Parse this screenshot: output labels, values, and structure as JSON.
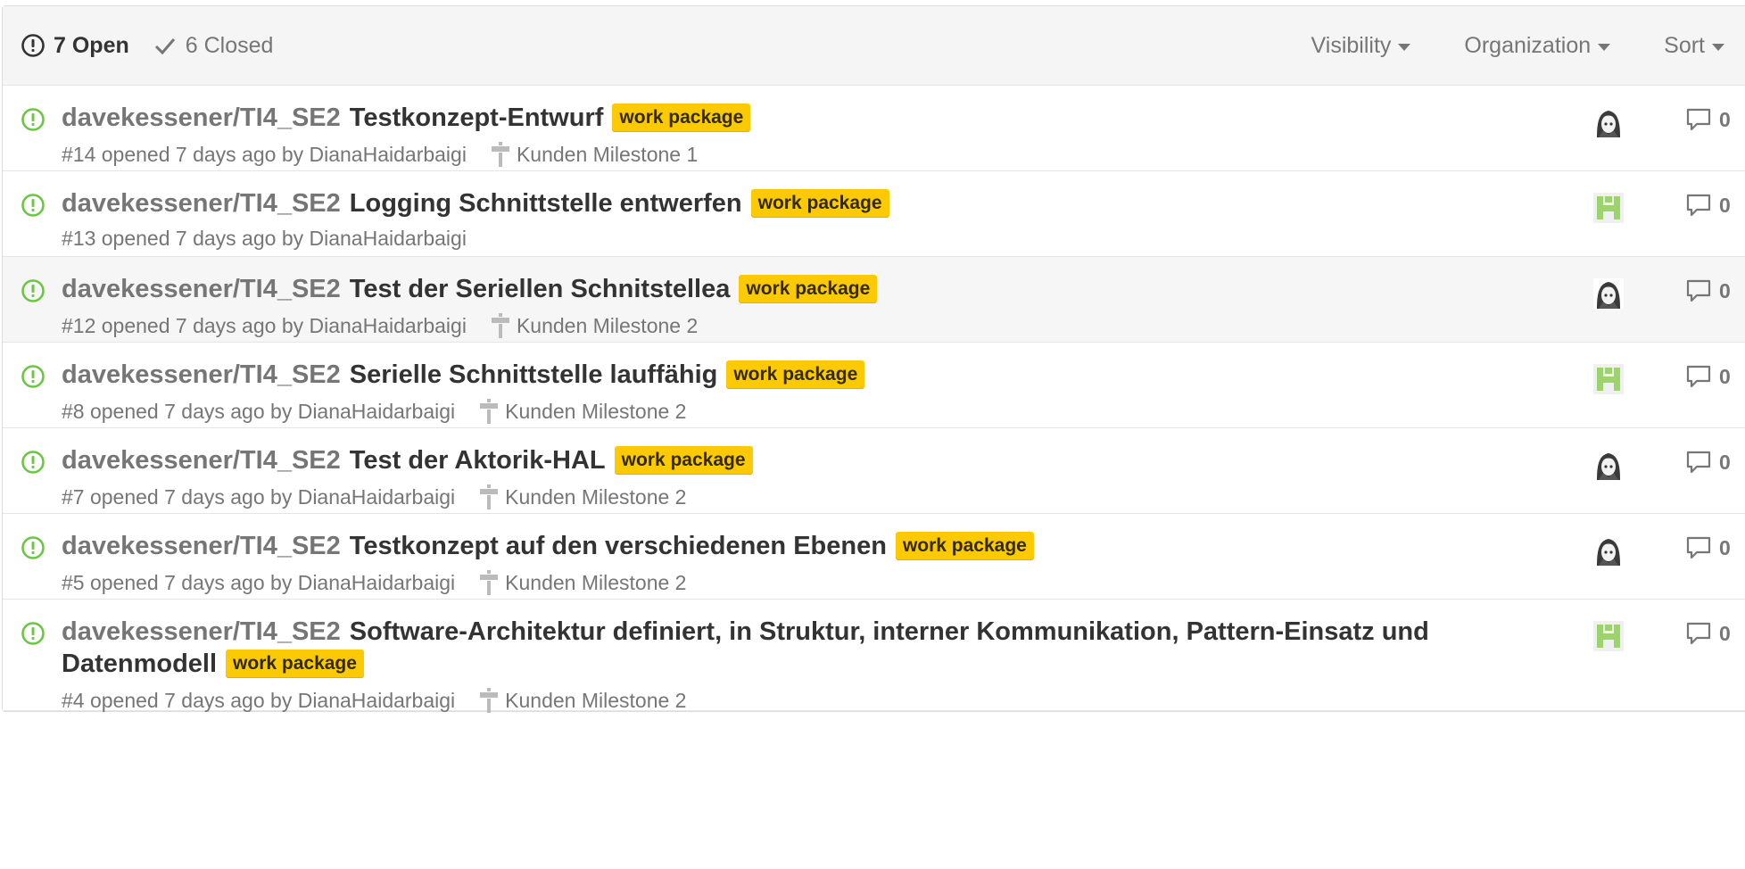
{
  "header": {
    "open_label": "7 Open",
    "closed_label": "6 Closed",
    "filters": [
      "Visibility",
      "Organization",
      "Sort"
    ]
  },
  "colors": {
    "open_icon": "#6cc644",
    "label_bg": "#fbca04",
    "muted": "#767676"
  },
  "issues": [
    {
      "repo": "davekessener/TI4_SE2",
      "title": "Testkonzept-Entwurf",
      "label": "work package",
      "meta": "#14 opened 7 days ago by DianaHaidarbaigi",
      "milestone": "Kunden Milestone 1",
      "avatar_icon": "anime-avatar",
      "comments": "0"
    },
    {
      "repo": "davekessener/TI4_SE2",
      "title": "Logging Schnittstelle entwerfen",
      "label": "work package",
      "meta": "#13 opened 7 days ago by DianaHaidarbaigi",
      "milestone": "",
      "avatar_icon": "identicon-avatar",
      "comments": "0"
    },
    {
      "repo": "davekessener/TI4_SE2",
      "title": "Test der Seriellen Schnitstellea",
      "label": "work package",
      "meta": "#12 opened 7 days ago by DianaHaidarbaigi",
      "milestone": "Kunden Milestone 2",
      "avatar_icon": "anime-avatar",
      "comments": "0"
    },
    {
      "repo": "davekessener/TI4_SE2",
      "title": "Serielle Schnittstelle lauffähig",
      "label": "work package",
      "meta": "#8 opened 7 days ago by DianaHaidarbaigi",
      "milestone": "Kunden Milestone 2",
      "avatar_icon": "identicon-avatar",
      "comments": "0"
    },
    {
      "repo": "davekessener/TI4_SE2",
      "title": "Test der Aktorik-HAL",
      "label": "work package",
      "meta": "#7 opened 7 days ago by DianaHaidarbaigi",
      "milestone": "Kunden Milestone 2",
      "avatar_icon": "anime-avatar",
      "comments": "0"
    },
    {
      "repo": "davekessener/TI4_SE2",
      "title": "Testkonzept auf den verschiedenen Ebenen",
      "label": "work package",
      "meta": "#5 opened 7 days ago by DianaHaidarbaigi",
      "milestone": "Kunden Milestone 2",
      "avatar_icon": "anime-avatar",
      "comments": "0"
    },
    {
      "repo": "davekessener/TI4_SE2",
      "title": "Software-Architektur definiert, in Struktur, interner Kommunikation, Pattern-Einsatz und Datenmodell",
      "label": "work package",
      "meta": "#4 opened 7 days ago by DianaHaidarbaigi",
      "milestone": "Kunden Milestone 2",
      "avatar_icon": "identicon-avatar",
      "comments": "0"
    }
  ]
}
